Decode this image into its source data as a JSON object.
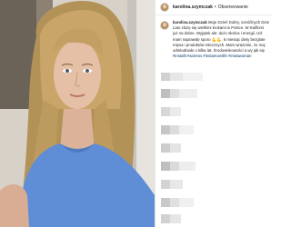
{
  "post": {
    "username": "karolina.szymczak",
    "separator": "•",
    "follow_label": "Obserwowanie"
  },
  "caption": {
    "username": "karolina.szymczak",
    "lines": [
      "Moje Dzień Dobry, sześćlnych Dzie",
      "Lato złożę się wielkimi krokami w Polsce. W Kaliforni",
      "już na dobre. Wyjątek ale: dużo słońca i energii. Ucł",
      "mam naprawdę sporo 💪💪. 6 miesiąc diety bezglute",
      "mięsa i produktów mlecznych. Mam wrażenie, że moj",
      "odmłodniało o kilka lat. Środowiskowości a wy jak się",
      "#instafit #actress #instamomlife #instawoman"
    ]
  },
  "colors": {
    "link": "#00376b",
    "text": "#262626",
    "border": "#efefef"
  }
}
